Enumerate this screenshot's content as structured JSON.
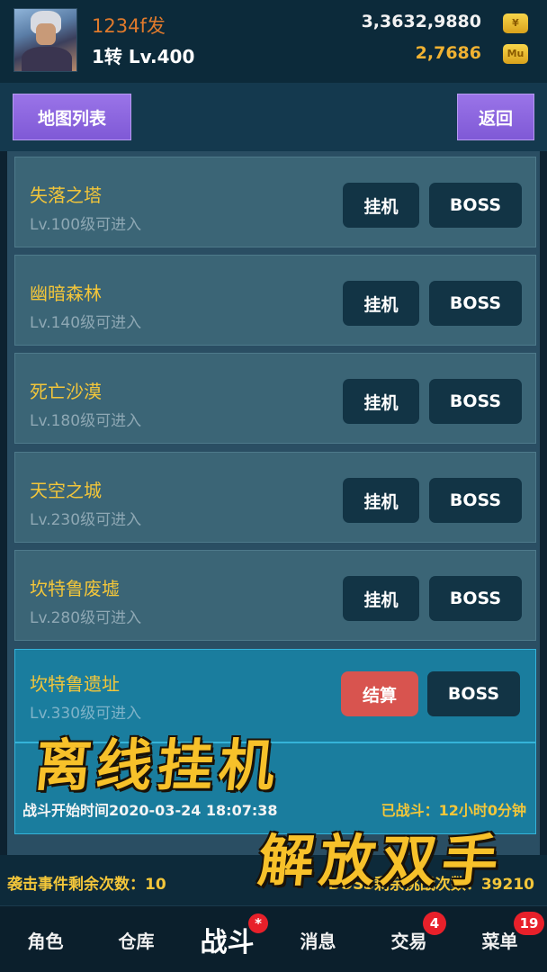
{
  "header": {
    "player_name": "1234f发",
    "player_level": "1转 Lv.400",
    "gold_amount": "3,3632,9880",
    "mu_amount": "2,7686",
    "gold_icon": "gold-coin-icon",
    "mu_icon": "mu-coin-icon",
    "mu_icon_text": "Mu"
  },
  "toolbar": {
    "map_list_label": "地图列表",
    "back_label": "返回"
  },
  "maps": [
    {
      "name": "失落之塔",
      "requirement": "Lv.100级可进入",
      "idle_label": "挂机",
      "boss_label": "BOSS"
    },
    {
      "name": "幽暗森林",
      "requirement": "Lv.140级可进入",
      "idle_label": "挂机",
      "boss_label": "BOSS"
    },
    {
      "name": "死亡沙漠",
      "requirement": "Lv.180级可进入",
      "idle_label": "挂机",
      "boss_label": "BOSS"
    },
    {
      "name": "天空之城",
      "requirement": "Lv.230级可进入",
      "idle_label": "挂机",
      "boss_label": "BOSS"
    },
    {
      "name": "坎特鲁废墟",
      "requirement": "Lv.280级可进入",
      "idle_label": "挂机",
      "boss_label": "BOSS"
    }
  ],
  "active_map": {
    "name": "坎特鲁遗址",
    "requirement": "Lv.330级可进入",
    "settle_label": "结算",
    "boss_label": "BOSS",
    "battle_start": "战斗开始时间2020-03-24 18:07:38",
    "battle_elapsed": "已战斗：12小时0分钟"
  },
  "promo": {
    "line1": "离线挂机",
    "line2": "解放双手"
  },
  "status": {
    "raid_remaining": "袭击事件剩余次数：10",
    "boss_remaining": "BOSS剩余挑战次数：39210"
  },
  "nav": [
    {
      "label": "角色",
      "badge": ""
    },
    {
      "label": "仓库",
      "badge": ""
    },
    {
      "label": "战斗",
      "badge": "*"
    },
    {
      "label": "消息",
      "badge": ""
    },
    {
      "label": "交易",
      "badge": "4"
    },
    {
      "label": "菜单",
      "badge": "19"
    }
  ],
  "colors": {
    "accent_purple": "#8a63de",
    "gold_text": "#f3c63a",
    "active_row": "#1a7d9e",
    "settle_red": "#d8544f",
    "badge_red": "#e8202a"
  }
}
